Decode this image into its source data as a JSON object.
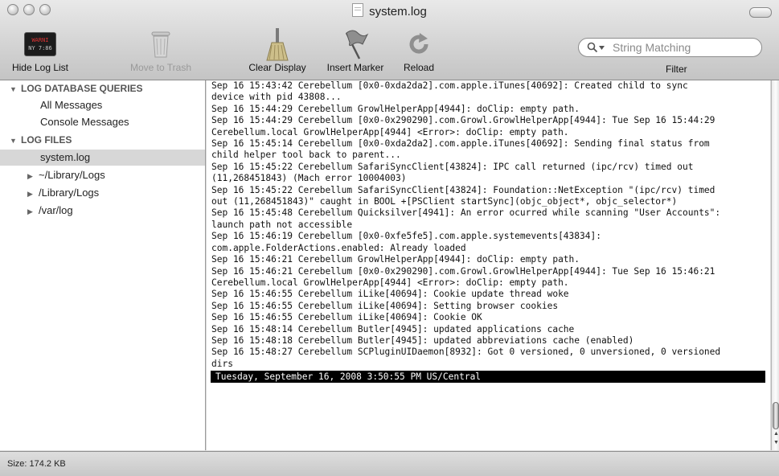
{
  "window": {
    "title": "system.log"
  },
  "toolbar": {
    "hide_log_list": "Hide Log List",
    "move_to_trash": "Move to Trash",
    "clear_display": "Clear Display",
    "insert_marker": "Insert Marker",
    "reload": "Reload",
    "hide_icon_text_1": "WARNI",
    "hide_icon_text_2": "NY 7:86"
  },
  "filter": {
    "placeholder": "String Matching",
    "label": "Filter"
  },
  "sidebar": {
    "queries_header": "LOG DATABASE QUERIES",
    "all_messages": "All Messages",
    "console_messages": "Console Messages",
    "files_header": "LOG FILES",
    "system_log": "system.log",
    "library_logs_user": "~/Library/Logs",
    "library_logs": "/Library/Logs",
    "var_log": "/var/log"
  },
  "log_lines": [
    "Sep 16 15:43:42 Cerebellum [0x0-0xda2da2].com.apple.iTunes[40692]: Created child to sync",
    "device with pid 43808...",
    "Sep 16 15:44:29 Cerebellum GrowlHelperApp[4944]: doClip: empty path.",
    "Sep 16 15:44:29 Cerebellum [0x0-0x290290].com.Growl.GrowlHelperApp[4944]: Tue Sep 16 15:44:29",
    "Cerebellum.local GrowlHelperApp[4944] <Error>: doClip: empty path.",
    "Sep 16 15:45:14 Cerebellum [0x0-0xda2da2].com.apple.iTunes[40692]: Sending final status from",
    "child helper tool back to parent...",
    "Sep 16 15:45:22 Cerebellum SafariSyncClient[43824]: IPC call returned (ipc/rcv) timed out",
    "(11,268451843) (Mach error 10004003)",
    "Sep 16 15:45:22 Cerebellum SafariSyncClient[43824]: Foundation::NetException \"(ipc/rcv) timed",
    "out (11,268451843)\" caught in BOOL +[PSClient startSync](objc_object*, objc_selector*)",
    "Sep 16 15:45:48 Cerebellum Quicksilver[4941]: An error ocurred while scanning \"User Accounts\":",
    "launch path not accessible",
    "Sep 16 15:46:19 Cerebellum [0x0-0xfe5fe5].com.apple.systemevents[43834]:",
    "com.apple.FolderActions.enabled: Already loaded",
    "Sep 16 15:46:21 Cerebellum GrowlHelperApp[4944]: doClip: empty path.",
    "Sep 16 15:46:21 Cerebellum [0x0-0x290290].com.Growl.GrowlHelperApp[4944]: Tue Sep 16 15:46:21",
    "Cerebellum.local GrowlHelperApp[4944] <Error>: doClip: empty path.",
    "Sep 16 15:46:55 Cerebellum iLike[40694]: Cookie update thread woke",
    "Sep 16 15:46:55 Cerebellum iLike[40694]: Setting browser cookies",
    "Sep 16 15:46:55 Cerebellum iLike[40694]: Cookie OK",
    "Sep 16 15:48:14 Cerebellum Butler[4945]: updated applications cache",
    "Sep 16 15:48:18 Cerebellum Butler[4945]: updated abbreviations cache (enabled)",
    "Sep 16 15:48:27 Cerebellum SCPluginUIDaemon[8932]: Got 0 versioned, 0 unversioned, 0 versioned",
    "dirs"
  ],
  "marker_text": "Tuesday, September 16, 2008 3:50:55 PM US/Central",
  "status": {
    "size": "Size: 174.2 KB"
  }
}
